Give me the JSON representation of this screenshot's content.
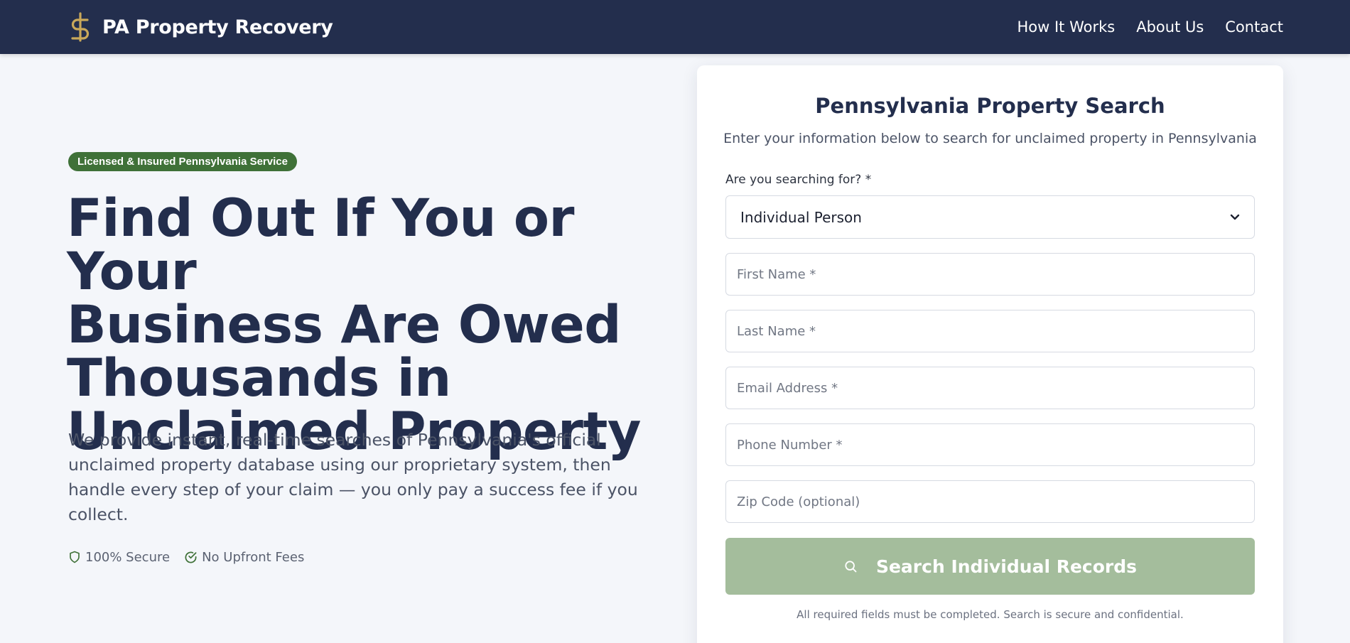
{
  "header": {
    "brand": "PA Property Recovery",
    "nav": [
      "How It Works",
      "About Us",
      "Contact"
    ]
  },
  "hero": {
    "badge": "Licensed & Insured Pennsylvania Service",
    "title_lines": [
      "Find Out If You or Your",
      "Business Are Owed",
      "Thousands in",
      "Unclaimed Property"
    ],
    "subtitle": "We provide instant, real-time searches of Pennsylvania's official unclaimed property database using our proprietary system, then handle every step of your claim — you only pay a success fee if you collect.",
    "trust": [
      "100% Secure",
      "No Upfront Fees"
    ]
  },
  "form": {
    "title": "Pennsylvania Property Search",
    "subtitle": "Enter your information below to search for unclaimed property in Pennsylvania",
    "type_label": "Are you searching for? *",
    "type_value": "Individual Person",
    "fields": {
      "first_name": "First Name *",
      "last_name": "Last Name *",
      "email": "Email Address *",
      "phone": "Phone Number *",
      "zip": "Zip Code (optional)"
    },
    "submit_label": "Search Individual Records",
    "footnote": "All required fields must be completed. Search is secure and confidential."
  },
  "colors": {
    "navy": "#232e4d",
    "gold": "#c9a85a",
    "green": "#3f7138",
    "button_disabled": "#a4bd9c"
  },
  "icons": {
    "logo": "dollar-sign-icon",
    "trust_secure": "shield-icon",
    "trust_fees": "check-circle-icon",
    "select": "chevron-down-icon",
    "submit": "search-icon"
  }
}
